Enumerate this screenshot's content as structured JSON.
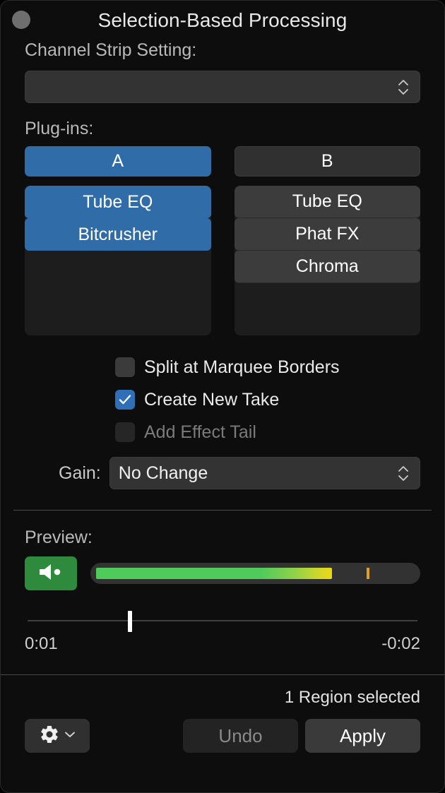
{
  "window": {
    "title": "Selection-Based Processing",
    "close_button": "close-button",
    "accent_blue": "#2f6ca8",
    "accent_green": "#2e8b3d",
    "background": "#0d0d0d"
  },
  "channel_strip": {
    "label": "Channel Strip Setting:",
    "value": "",
    "placeholder": ""
  },
  "plugins": {
    "label": "Plug-ins:",
    "columns": [
      {
        "header": "A",
        "selected": true,
        "items": [
          {
            "label": "Tube EQ",
            "selected": true
          },
          {
            "label": "Bitcrusher",
            "selected": true
          }
        ]
      },
      {
        "header": "B",
        "selected": false,
        "items": [
          {
            "label": "Tube EQ",
            "selected": false
          },
          {
            "label": "Phat FX",
            "selected": false
          },
          {
            "label": "Chroma",
            "selected": false
          }
        ]
      }
    ]
  },
  "options": [
    {
      "label": "Split at Marquee Borders",
      "checked": false,
      "disabled": false
    },
    {
      "label": "Create New Take",
      "checked": true,
      "disabled": false
    },
    {
      "label": "Add Effect Tail",
      "checked": false,
      "disabled": true
    }
  ],
  "gain": {
    "label": "Gain:",
    "value": "No Change"
  },
  "preview": {
    "label": "Preview:",
    "speaker_icon": "speaker-icon",
    "meter": {
      "level_percent": 74,
      "peak_percent": 85,
      "green_color": "#4ecb5a",
      "yellow_color": "#e8d80f",
      "peak_color": "#e0a020"
    },
    "scrubber": {
      "position_percent": 26,
      "elapsed": "0:01",
      "remaining": "-0:02"
    }
  },
  "footer": {
    "status": "1 Region selected",
    "gear_button": "gear-icon",
    "undo_label": "Undo",
    "undo_disabled": true,
    "apply_label": "Apply",
    "apply_disabled": false
  }
}
